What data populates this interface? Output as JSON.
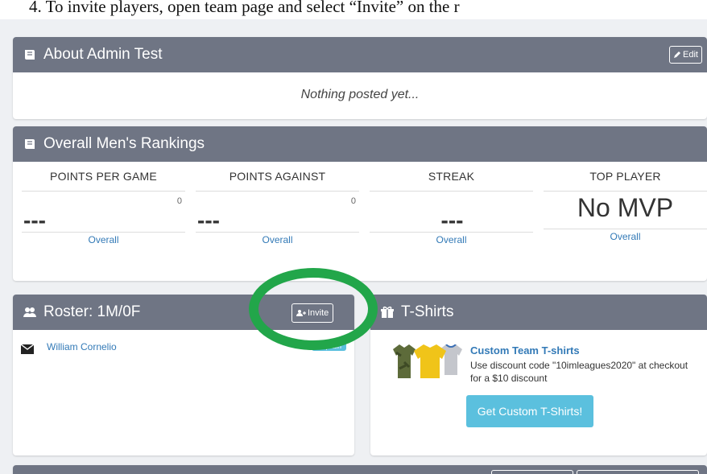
{
  "caption": "4.   To invite players, open team page and select “Invite” on the r",
  "about": {
    "title": "About Admin Test",
    "edit_label": "Edit",
    "body": "Nothing posted yet..."
  },
  "rankings": {
    "title": "Overall Men's Rankings",
    "stats": [
      {
        "label": "POINTS PER GAME",
        "count": "0",
        "value": "---",
        "link": "Overall"
      },
      {
        "label": "POINTS AGAINST",
        "count": "0",
        "value": "---",
        "link": "Overall"
      },
      {
        "label": "STREAK",
        "count": "",
        "value": "---",
        "link": "Overall"
      },
      {
        "label": "TOP PLAYER",
        "count": "",
        "value": "No MVP",
        "link": "Overall"
      }
    ]
  },
  "roster": {
    "title": "Roster: 1M/0F",
    "invite_label": "Invite",
    "members": [
      {
        "name": "William Cornelio",
        "badge": "Captain"
      }
    ]
  },
  "tshirts": {
    "title": "T-Shirts",
    "promo_title": "Custom Team T-shirts",
    "promo_desc": "Use discount code \"10imleagues2020\" at checkout for a $10 discount",
    "button_label": "Get Custom T-Shirts!"
  },
  "colors": {
    "header_bg": "#6f7584",
    "link": "#337ab7",
    "accent_btn": "#5bc0de",
    "highlight": "#22a64a"
  },
  "icons": {
    "book": "book-icon",
    "users": "users-icon",
    "gift": "gift-icon",
    "envelope": "envelope-icon",
    "pencil": "pencil-icon",
    "add_user": "add-user-icon"
  }
}
